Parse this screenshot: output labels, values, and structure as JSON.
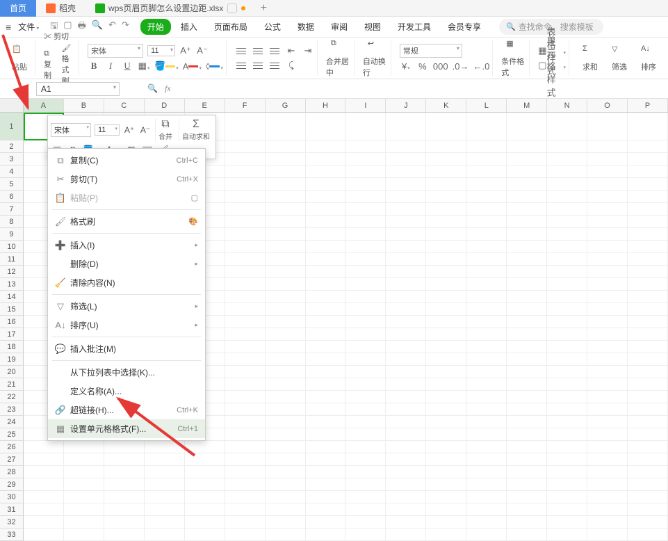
{
  "tabs": {
    "home": "首页",
    "doker": "稻壳",
    "file": "wps页眉页脚怎么设置边距.xlsx"
  },
  "file_menu": "文件",
  "ribbon_tabs": [
    "开始",
    "插入",
    "页面布局",
    "公式",
    "数据",
    "审阅",
    "视图",
    "开发工具",
    "会员专享"
  ],
  "search_placeholder": "查找命令、搜索模板",
  "clipboard": {
    "paste": "粘贴",
    "cut": "剪切",
    "copy": "复制",
    "format_painter": "格式刷"
  },
  "font": {
    "name": "宋体",
    "size": "11"
  },
  "merge_label": "合并居中",
  "wrap_label": "自动换行",
  "currency_label": "常规",
  "cond_format": "条件格式",
  "table_style": "表格样式",
  "cell_style": "单元格样式",
  "sum_label": "求和",
  "filter_label": "筛选",
  "sort_label": "排序",
  "name_box": "A1",
  "columns": [
    "A",
    "B",
    "C",
    "D",
    "E",
    "F",
    "G",
    "H",
    "I",
    "J",
    "K",
    "L",
    "M",
    "N",
    "O",
    "P"
  ],
  "mini": {
    "font": "宋体",
    "size": "11",
    "merge": "合并",
    "autosum": "自动求和"
  },
  "context": {
    "copy": {
      "label": "复制(C)",
      "sc": "Ctrl+C"
    },
    "cut": {
      "label": "剪切(T)",
      "sc": "Ctrl+X"
    },
    "paste": {
      "label": "粘贴(P)"
    },
    "format_painter": {
      "label": "格式刷"
    },
    "insert": {
      "label": "插入(I)"
    },
    "delete": {
      "label": "删除(D)"
    },
    "clear": {
      "label": "清除内容(N)"
    },
    "filter": {
      "label": "筛选(L)"
    },
    "sort": {
      "label": "排序(U)"
    },
    "comment": {
      "label": "插入批注(M)"
    },
    "dropdown": {
      "label": "从下拉列表中选择(K)..."
    },
    "define_name": {
      "label": "定义名称(A)..."
    },
    "hyperlink": {
      "label": "超链接(H)...",
      "sc": "Ctrl+K"
    },
    "format_cells": {
      "label": "设置单元格格式(F)...",
      "sc": "Ctrl+1"
    }
  }
}
